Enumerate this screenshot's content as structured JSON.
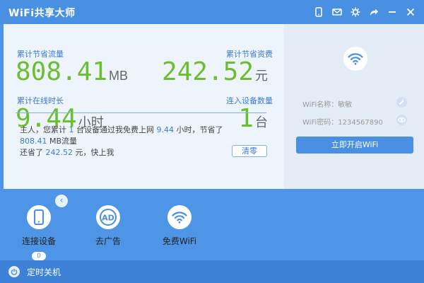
{
  "app": {
    "title": "WiFi共享大师"
  },
  "titlebar": {
    "icons": [
      "phone-icon",
      "mail-icon",
      "settings-icon",
      "share-icon",
      "minimize-icon",
      "close-icon"
    ]
  },
  "stats": {
    "traffic_saved": {
      "label": "累计节省流量",
      "value": "808.41",
      "unit": "MB"
    },
    "money_saved": {
      "label": "累计节省资费",
      "value": "242.52",
      "unit": "元"
    },
    "online_time": {
      "label": "累计在线时长",
      "value": "9.44",
      "unit": "小时"
    },
    "devices": {
      "label": "连入设备数量",
      "value": "1",
      "unit": "台"
    }
  },
  "summary": {
    "p1": "主人，您累计",
    "devices": "1",
    "p2": "台设备通过我免费上网",
    "hours": "9.44",
    "p3": "小时，节省了",
    "traffic": "808.41",
    "p4": "MB流量",
    "p5": "还省了",
    "money": "242.52",
    "p6": "元，快上我",
    "clear_label": "清零"
  },
  "wifi": {
    "name_line": "WiFi名称：敏敏",
    "password_line": "WiFi密码：1234567890",
    "start_label": "立即开启WiFi"
  },
  "tools": {
    "connect": {
      "label": "连接设备",
      "badge": "0"
    },
    "ads": {
      "label": "去广告",
      "icon_text": "AD"
    },
    "free_wifi": {
      "label": "免费WiFi"
    }
  },
  "footer": {
    "timer_label": "定时关机"
  },
  "colors": {
    "accent": "#4a90e2",
    "value_green": "#6bbf2f",
    "label_blue": "#3a7bd5"
  }
}
